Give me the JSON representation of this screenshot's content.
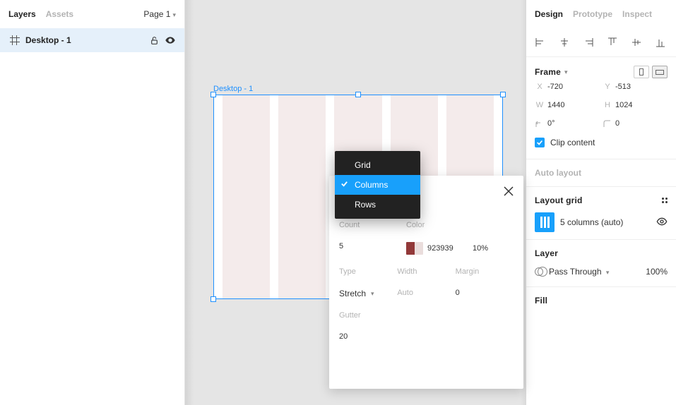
{
  "left": {
    "tab_layers": "Layers",
    "tab_assets": "Assets",
    "page_label": "Page 1",
    "layer_name": "Desktop - 1"
  },
  "canvas": {
    "frame_label": "Desktop - 1"
  },
  "dropdown": {
    "grid": "Grid",
    "columns": "Columns",
    "rows": "Rows"
  },
  "popover": {
    "count_label": "Count",
    "color_label": "Color",
    "count_value": "5",
    "color_hex": "923939",
    "color_opacity": "10%",
    "type_label": "Type",
    "width_label": "Width",
    "margin_label": "Margin",
    "type_value": "Stretch",
    "width_value": "Auto",
    "margin_value": "0",
    "gutter_label": "Gutter",
    "gutter_value": "20"
  },
  "right": {
    "tab_design": "Design",
    "tab_prototype": "Prototype",
    "tab_inspect": "Inspect",
    "frame_title": "Frame",
    "x_label": "X",
    "x_value": "-720",
    "y_label": "Y",
    "y_value": "-513",
    "w_label": "W",
    "w_value": "1440",
    "h_label": "H",
    "h_value": "1024",
    "rot_value": "0°",
    "radius_value": "0",
    "clip_label": "Clip content",
    "auto_layout_label": "Auto layout",
    "layout_grid_title": "Layout grid",
    "layout_grid_item": "5 columns (auto)",
    "layer_title": "Layer",
    "blend_mode": "Pass Through",
    "opacity": "100%",
    "fill_title": "Fill"
  }
}
